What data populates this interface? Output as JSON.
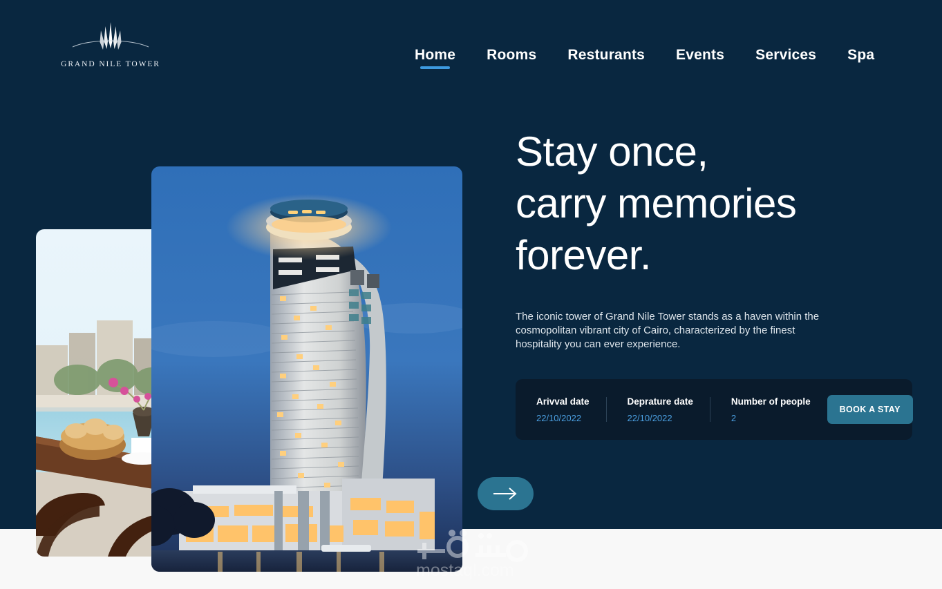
{
  "brand": {
    "name": "GRAND NILE TOWER",
    "logo_icon": "nile-tower-logo-icon"
  },
  "nav": {
    "items": [
      {
        "label": "Home",
        "active": true
      },
      {
        "label": "Rooms",
        "active": false
      },
      {
        "label": "Resturants",
        "active": false
      },
      {
        "label": "Events",
        "active": false
      },
      {
        "label": "Services",
        "active": false
      },
      {
        "label": "Spa",
        "active": false
      }
    ],
    "active_underline_color": "#3d9ae0"
  },
  "hero": {
    "title_line1": "Stay once,",
    "title_line2": "carry memories",
    "title_line3": "forever.",
    "paragraph": "The iconic tower of Grand Nile Tower stands as a haven within the cosmopolitan vibrant city of Cairo, characterized by the finest hospitality you can ever experience.",
    "next_arrow_icon": "arrow-right-icon"
  },
  "gallery": {
    "main_image_alt": "grand-nile-tower-at-dusk",
    "secondary_image_alt": "nile-view-breakfast-terrace"
  },
  "booking": {
    "arrival": {
      "label": "Arivval date",
      "value": "22/10/2022"
    },
    "departure": {
      "label": "Deprature date",
      "value": "22/10/2022"
    },
    "people": {
      "label": "Number of people",
      "value": "2"
    },
    "cta_label": "BOOK A STAY",
    "cta_color": "#2b7491",
    "value_color": "#4b9fe0"
  },
  "watermark": {
    "text": "mostaql.com",
    "arabic": "مستقل"
  },
  "theme": {
    "background": "#092740",
    "panel": "#0a1b2c",
    "accent": "#2b7491",
    "page_bottom": "#f8f8f8"
  }
}
